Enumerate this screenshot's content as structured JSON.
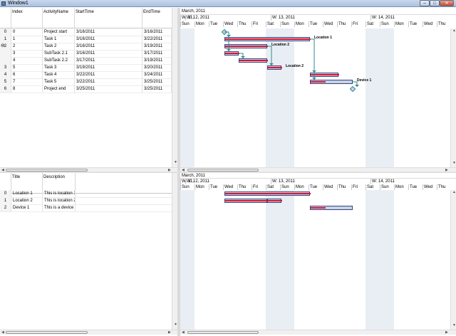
{
  "window": {
    "title": "Window1",
    "min": "–",
    "max": "□",
    "close": "✕"
  },
  "task_grid": {
    "columns": [
      "Index",
      "ActivityName",
      "StartTime",
      "EndTime"
    ],
    "rows": [
      {
        "hdr": "0",
        "index": "0",
        "name": "Project start",
        "start": "3/16/2011",
        "end": "3/16/2011",
        "expander": ""
      },
      {
        "hdr": "1",
        "index": "1",
        "name": "Task 1",
        "start": "3/16/2011",
        "end": "3/22/2011",
        "expander": ""
      },
      {
        "hdr": "2",
        "index": "2",
        "name": "Task 2",
        "start": "3/16/2011",
        "end": "3/19/2011",
        "expander": "⊖"
      },
      {
        "hdr": "",
        "index": "3",
        "name": "SubTask 2.1",
        "start": "3/16/2011",
        "end": "3/17/2011",
        "expander": ""
      },
      {
        "hdr": "",
        "index": "4",
        "name": "SubTask 2.2",
        "start": "3/17/2011",
        "end": "3/19/2011",
        "expander": ""
      },
      {
        "hdr": "3",
        "index": "5",
        "name": "Task 3",
        "start": "3/19/2011",
        "end": "3/20/2011",
        "expander": ""
      },
      {
        "hdr": "4",
        "index": "6",
        "name": "Task 4",
        "start": "3/22/2011",
        "end": "3/24/2011",
        "expander": ""
      },
      {
        "hdr": "5",
        "index": "7",
        "name": "Task 5",
        "start": "3/22/2011",
        "end": "3/25/2011",
        "expander": ""
      },
      {
        "hdr": "6",
        "index": "8",
        "name": "Project end",
        "start": "3/25/2011",
        "end": "3/25/2011",
        "expander": ""
      }
    ]
  },
  "resource_grid": {
    "columns": [
      "Title",
      "Description"
    ],
    "rows": [
      {
        "hdr": "0",
        "title": "Location 1",
        "desc": "This is location 1"
      },
      {
        "hdr": "1",
        "title": "Location 2",
        "desc": "This is location 2"
      },
      {
        "hdr": "2",
        "title": "Device 1",
        "desc": "This is a device"
      }
    ]
  },
  "timeline": {
    "month": "March, 2011",
    "weeks": [
      "W: 11,",
      "W: 12, 2011",
      "W: 13, 2011",
      "W: 14, 2011"
    ],
    "days": [
      "Sun",
      "Mon",
      "Tue",
      "Wed",
      "Thu",
      "Fri",
      "Sat",
      "Sun",
      "Mon",
      "Tue",
      "Wed",
      "Thu",
      "Fri",
      "Sat",
      "Sun",
      "Mon",
      "Tue",
      "Wed",
      "Thu"
    ]
  },
  "gantt": {
    "labels": [
      "Location 1",
      "Location 2",
      "Location 2",
      "Device 1"
    ]
  },
  "colors": {
    "bar_fill": "#c7d3e8",
    "bar_border": "#37437a",
    "progress": "#e0102c",
    "link": "#2e8a8f",
    "weekend": "#e9eef5"
  }
}
